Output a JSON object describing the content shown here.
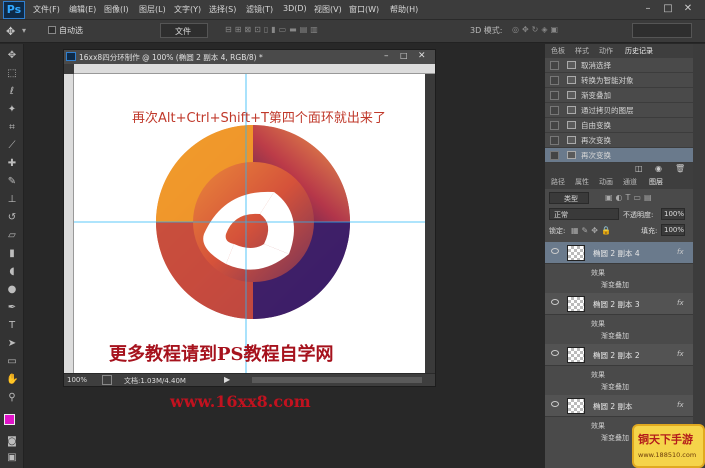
{
  "app": {
    "logo": "Ps",
    "menu": [
      "文件(F)",
      "编辑(E)",
      "图像(I)",
      "图层(L)",
      "文字(Y)",
      "选择(S)",
      "滤镜(T)",
      "3D(D)",
      "视图(V)",
      "窗口(W)",
      "帮助(H)"
    ]
  },
  "options": {
    "auto_select": "自动选",
    "doc_button": "文件",
    "mode_3d": "3D 模式:"
  },
  "document": {
    "title": "16xx8四分环制作 @ 100% (椭圆 2 副本 4, RGB/8) *",
    "zoom": "100%",
    "doc_size": "文档:1.03M/4.40M",
    "canvas_note": "再次Alt+Ctrl+Shift+T第四个面环就出来了",
    "footer_text": "更多教程请到PS教程自学网"
  },
  "site_url": "www.16xx8.com",
  "history": {
    "tabs": [
      "色板",
      "样式",
      "动作",
      "历史记录"
    ],
    "items": [
      "取消选择",
      "转换为智能对象",
      "渐变叠加",
      "通过拷贝的图层",
      "自由变换",
      "再次变换",
      "再次变换"
    ]
  },
  "layers": {
    "tabs": [
      "路径",
      "属性",
      "动画",
      "通道",
      "图层"
    ],
    "filter_kind": "类型",
    "blend_mode": "正常",
    "opacity_label": "不透明度:",
    "opacity_value": "100%",
    "lock_label": "锁定:",
    "fill_label": "填充:",
    "fill_value": "100%",
    "items": [
      {
        "name": "椭圆 2 副本 4",
        "effects_label": "效果",
        "effect": "渐变叠加"
      },
      {
        "name": "椭圆 2 副本 3",
        "effects_label": "效果",
        "effect": "渐变叠加"
      },
      {
        "name": "椭圆 2 副本 2",
        "effects_label": "效果",
        "effect": "渐变叠加"
      },
      {
        "name": "椭圆 2 副本",
        "effects_label": "效果",
        "effect": "渐变叠加"
      }
    ],
    "fx": "fx"
  },
  "watermark": {
    "line1": "铜天下手游",
    "line2": "www.188510.com"
  },
  "colors": {
    "ring_outer": "#f29a2e",
    "ring_mid": "#c2463f",
    "ring_inner": "#3b1f6b",
    "canvas_text": "#c0392b",
    "footer_text": "#a6121d",
    "foreground_swatch": "#e015c9"
  }
}
